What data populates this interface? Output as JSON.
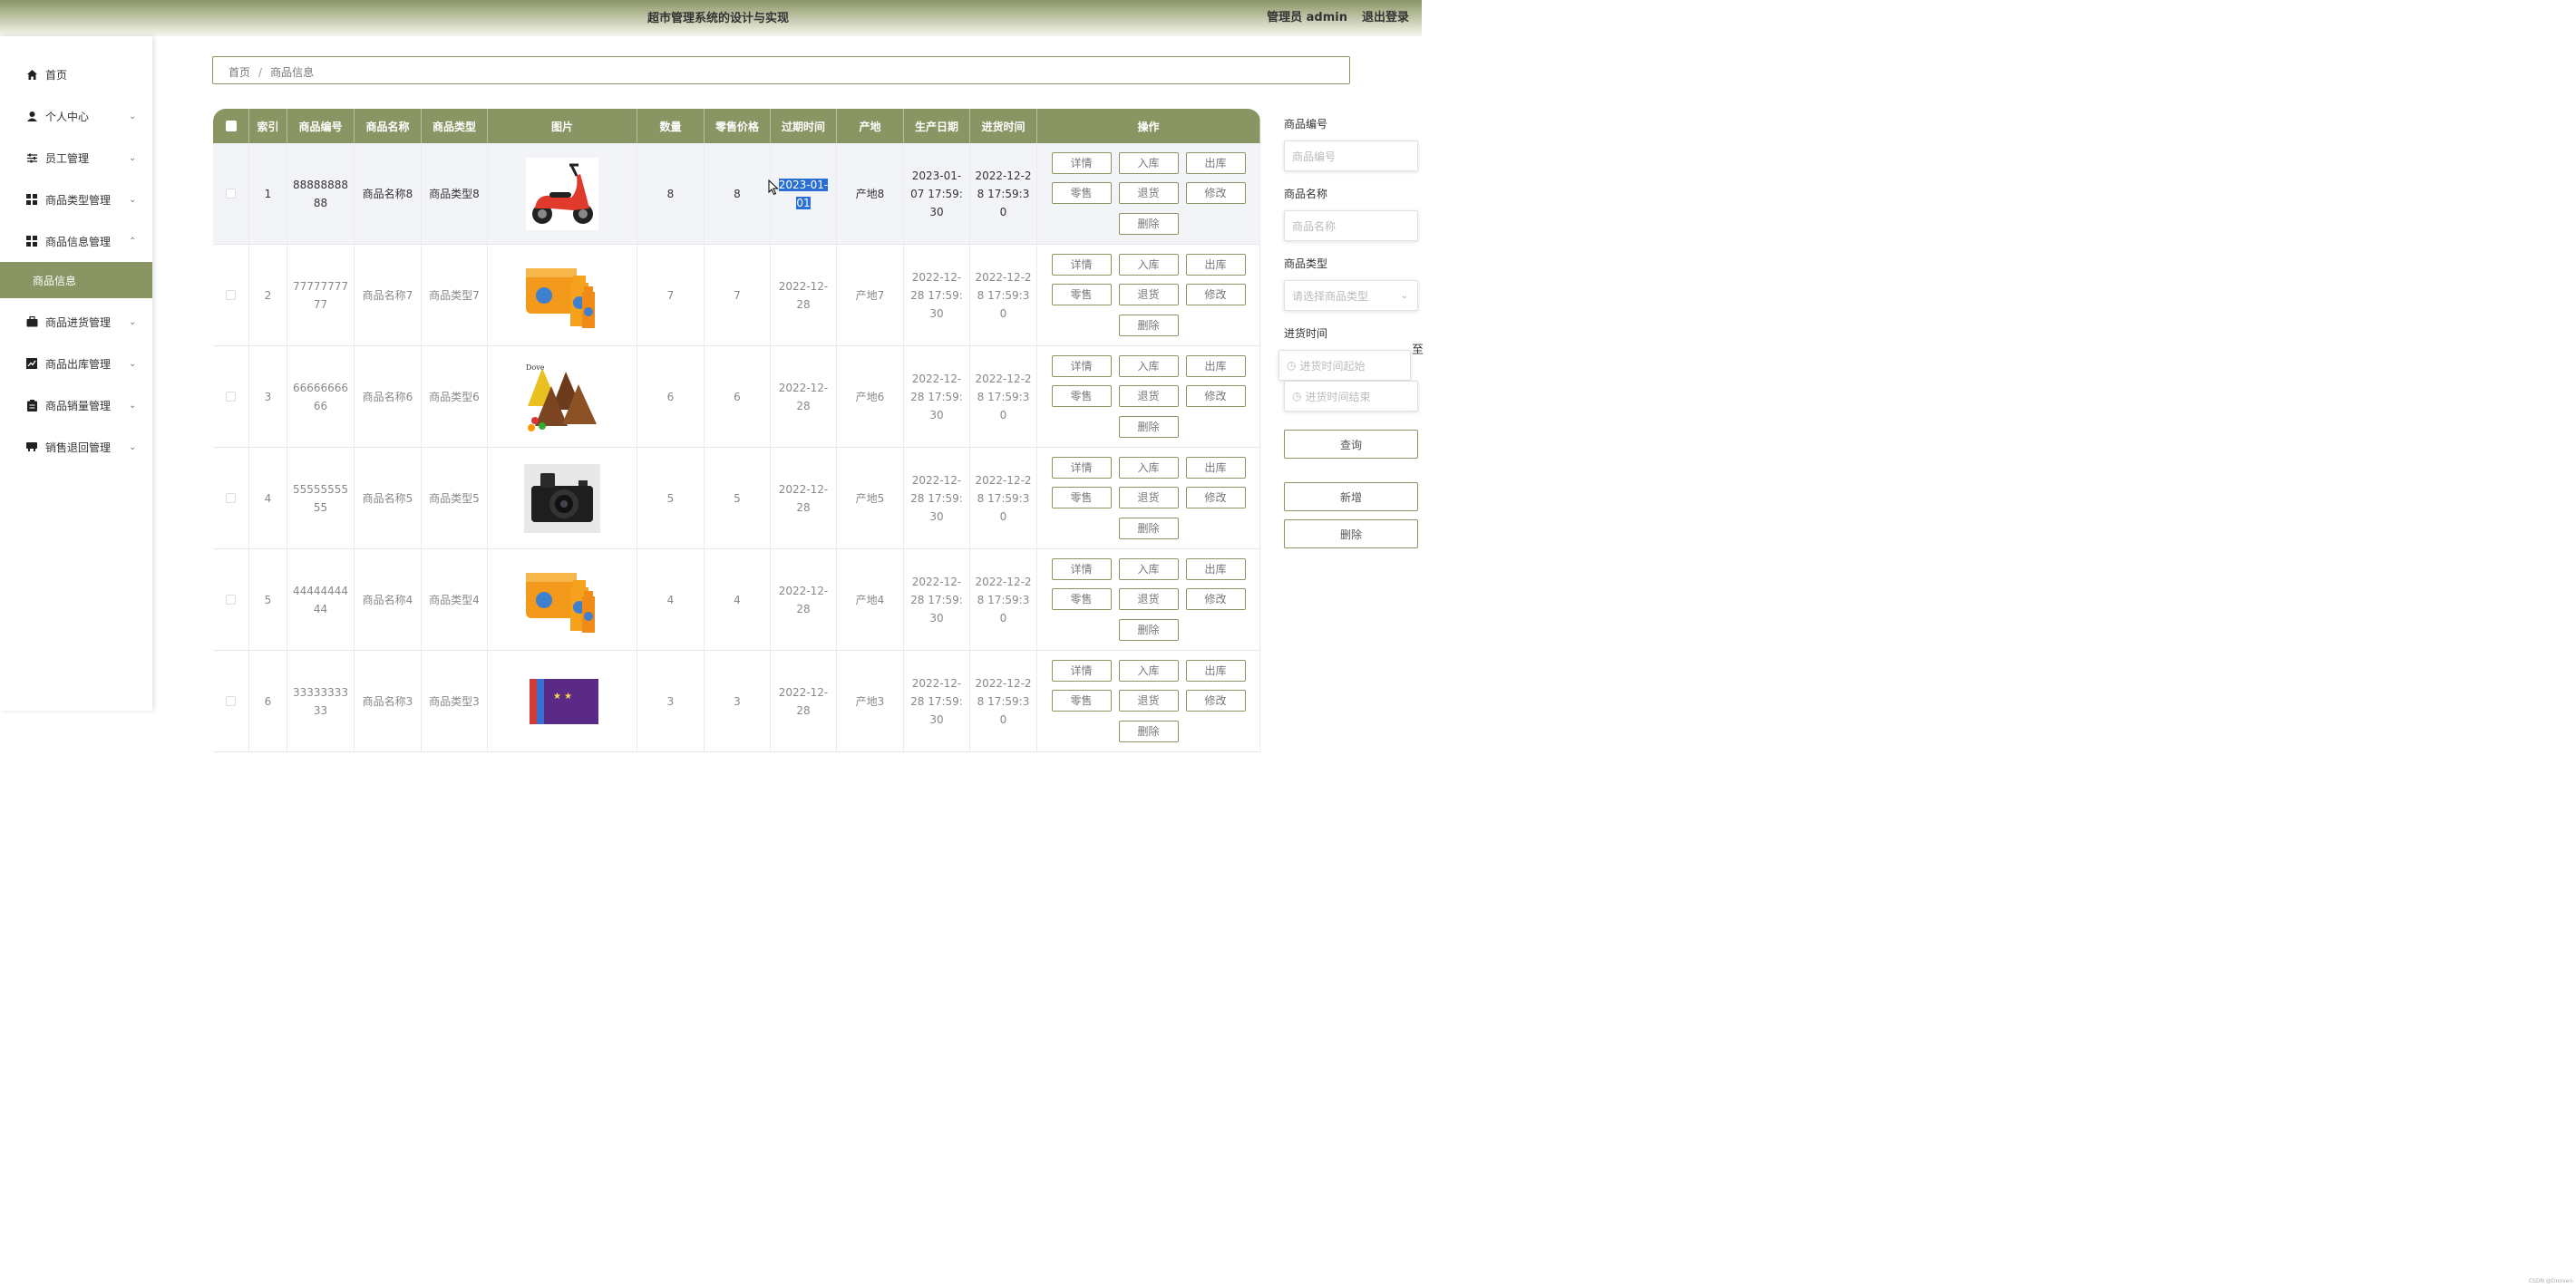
{
  "header": {
    "title": "超市管理系统的设计与实现",
    "user": "管理员 admin",
    "logout": "退出登录"
  },
  "sidebar": {
    "items": [
      {
        "label": "首页",
        "icon": "home-icon",
        "arrow": ""
      },
      {
        "label": "个人中心",
        "icon": "user-icon",
        "arrow": "⌄"
      },
      {
        "label": "员工管理",
        "icon": "sliders-icon",
        "arrow": "⌄"
      },
      {
        "label": "商品类型管理",
        "icon": "grid-icon",
        "arrow": "⌄"
      },
      {
        "label": "商品信息管理",
        "icon": "grid-icon",
        "arrow": "⌃"
      }
    ],
    "active_sub": "商品信息",
    "items2": [
      {
        "label": "商品进货管理",
        "icon": "briefcase-icon",
        "arrow": "⌄"
      },
      {
        "label": "商品出库管理",
        "icon": "chart-icon",
        "arrow": "⌄"
      },
      {
        "label": "商品销量管理",
        "icon": "clipboard-icon",
        "arrow": "⌄"
      },
      {
        "label": "销售退回管理",
        "icon": "store-icon",
        "arrow": "⌄"
      }
    ]
  },
  "breadcrumb": {
    "home": "首页",
    "sep": "/",
    "current": "商品信息"
  },
  "table": {
    "headers": [
      "索引",
      "商品编号",
      "商品名称",
      "商品类型",
      "图片",
      "数量",
      "零售价格",
      "过期时间",
      "产地",
      "生产日期",
      "进货时间",
      "操作"
    ],
    "buttons": {
      "detail": "详情",
      "in": "入库",
      "out": "出库",
      "retail": "零售",
      "return": "退货",
      "edit": "修改",
      "delete": "删除"
    },
    "rows": [
      {
        "index": "1",
        "code": "8888888888",
        "name": "商品名称8",
        "type": "商品类型8",
        "image": "scooter",
        "qty": "8",
        "price": "8",
        "expire_a": "2023-01-",
        "expire_b": "01",
        "origin": "产地8",
        "produce": "2023-01-07 17:59:30",
        "stock": "2022-12-28 17:59:30"
      },
      {
        "index": "2",
        "code": "7777777777",
        "name": "商品名称7",
        "type": "商品类型7",
        "image": "juice",
        "qty": "7",
        "price": "7",
        "expire_a": "2022-12-",
        "expire_b": "28",
        "origin": "产地7",
        "produce": "2022-12-28 17:59:30",
        "stock": "2022-12-28 17:59:30"
      },
      {
        "index": "3",
        "code": "6666666666",
        "name": "商品名称6",
        "type": "商品类型6",
        "image": "chocolate",
        "qty": "6",
        "price": "6",
        "expire_a": "2022-12-",
        "expire_b": "28",
        "origin": "产地6",
        "produce": "2022-12-28 17:59:30",
        "stock": "2022-12-28 17:59:30"
      },
      {
        "index": "4",
        "code": "5555555555",
        "name": "商品名称5",
        "type": "商品类型5",
        "image": "camera",
        "qty": "5",
        "price": "5",
        "expire_a": "2022-12-",
        "expire_b": "28",
        "origin": "产地5",
        "produce": "2022-12-28 17:59:30",
        "stock": "2022-12-28 17:59:30"
      },
      {
        "index": "5",
        "code": "4444444444",
        "name": "商品名称4",
        "type": "商品类型4",
        "image": "juice",
        "qty": "4",
        "price": "4",
        "expire_a": "2022-12-",
        "expire_b": "28",
        "origin": "产地4",
        "produce": "2022-12-28 17:59:30",
        "stock": "2022-12-28 17:59:30"
      },
      {
        "index": "6",
        "code": "3333333333",
        "name": "商品名称3",
        "type": "商品类型3",
        "image": "books",
        "qty": "3",
        "price": "3",
        "expire_a": "2022-12-",
        "expire_b": "28",
        "origin": "产地3",
        "produce": "2022-12-28 17:59:30",
        "stock": "2022-12-28 17:59:30"
      }
    ]
  },
  "search": {
    "code_label": "商品编号",
    "code_placeholder": "商品编号",
    "name_label": "商品名称",
    "name_placeholder": "商品名称",
    "type_label": "商品类型",
    "type_placeholder": "请选择商品类型",
    "time_label": "进货时间",
    "time_start": "进货时间起始",
    "time_end": "进货时间结束",
    "to": "至",
    "query": "查询",
    "add": "新增",
    "delete": "删除"
  },
  "watermark": "CSDN @Dnoven"
}
